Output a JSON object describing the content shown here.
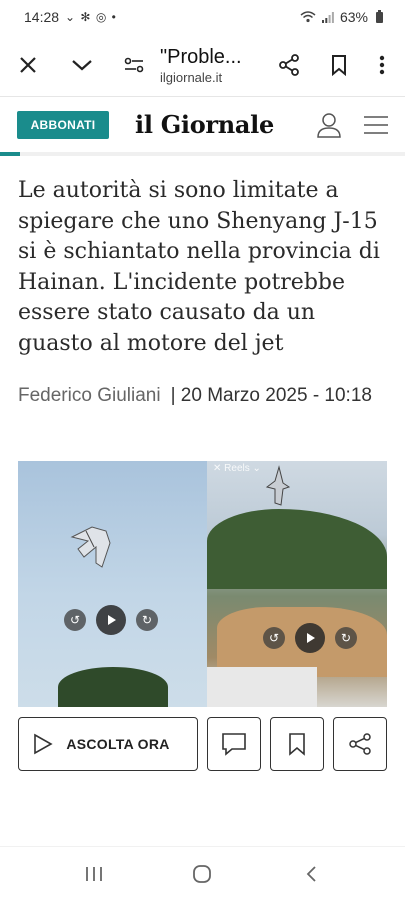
{
  "status_bar": {
    "time": "14:28",
    "notif_icons": "⌄ ✻ ◎ •",
    "battery": "63%"
  },
  "browser": {
    "page_title": "\"Proble...",
    "domain": "ilgiornale.it"
  },
  "site": {
    "subscribe_label": "ABBONATI",
    "logo": "il Giornale",
    "scroll_progress": 0.05
  },
  "article": {
    "subtitle": "Le autorità si sono limitate a spiegare che uno Shenyang J-15 si è schiantato nella provincia di Hainan. L'incidente potrebbe essere stato causato da un guasto al motore del jet",
    "author": "Federico Giuliani",
    "date": "| 20 Marzo 2025 - 10:18"
  },
  "media": {
    "reels_label": "✕ Reels ⌄"
  },
  "actions": {
    "listen_label": "ASCOLTA ORA"
  },
  "icons": [
    "close-icon",
    "chevron-down-icon",
    "page-settings-icon",
    "share-icon",
    "bookmark-icon",
    "more-icon",
    "user-icon",
    "menu-icon",
    "play-icon",
    "comment-icon"
  ],
  "colors": {
    "accent": "#1a8c8c"
  }
}
